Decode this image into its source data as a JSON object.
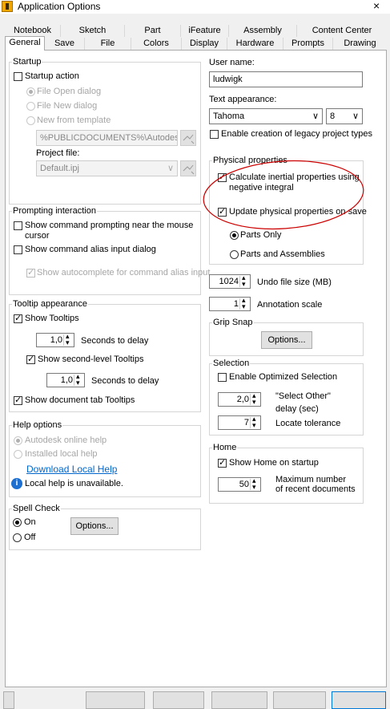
{
  "window": {
    "title": "Application Options",
    "close": "×"
  },
  "tabs_row1": [
    "Notebook",
    "Sketch",
    "Part",
    "iFeature",
    "Assembly",
    "Content Center"
  ],
  "tabs_row2": [
    "General",
    "Save",
    "File",
    "Colors",
    "Display",
    "Hardware",
    "Prompts",
    "Drawing"
  ],
  "active_tab": "General",
  "startup": {
    "group_label": "Startup",
    "startup_action": "Startup action",
    "file_open": "File Open dialog",
    "file_new": "File New dialog",
    "new_from_template": "New from template",
    "template_path": "%PUBLICDOCUMENTS%\\Autodesk\\Inv",
    "project_file_label": "Project file:",
    "project_file_value": "Default.ipj"
  },
  "prompting": {
    "group_label": "Prompting interaction",
    "show_cmd_prompting": "Show command prompting near the mouse cursor",
    "show_alias": "Show command alias input dialog",
    "show_autocomplete": "Show autocomplete for command alias input"
  },
  "tooltip": {
    "group_label": "Tooltip appearance",
    "show_tooltips": "Show Tooltips",
    "delay1_value": "1,0",
    "delay1_label": "Seconds to delay",
    "show_second": "Show second-level Tooltips",
    "delay2_value": "1,0",
    "delay2_label": "Seconds to delay",
    "show_doc_tab": "Show document tab Tooltips"
  },
  "help": {
    "group_label": "Help options",
    "online": "Autodesk online help",
    "installed": "Installed local help",
    "download": "Download Local Help",
    "unavailable": "Local help is unavailable."
  },
  "spell": {
    "group_label": "Spell Check",
    "on": "On",
    "off": "Off",
    "options": "Options..."
  },
  "user": {
    "user_name_label": "User name:",
    "user_name_value": "ludwigk",
    "text_appearance_label": "Text appearance:",
    "font": "Tahoma",
    "size": "8",
    "legacy": "Enable creation of legacy project types"
  },
  "physical": {
    "group_label": "Physical properties",
    "inertial": "Calculate inertial properties using negative integral",
    "update": "Update physical properties on save",
    "parts_only": "Parts Only",
    "parts_assemblies": "Parts and Assemblies"
  },
  "undo": {
    "value": "1024",
    "label": "Undo file size (MB)"
  },
  "annotation": {
    "value": "1",
    "label": "Annotation scale"
  },
  "grip": {
    "group_label": "Grip Snap",
    "options": "Options..."
  },
  "selection": {
    "group_label": "Selection",
    "optimized": "Enable Optimized Selection",
    "select_other_value": "2,0",
    "select_other_label": "\"Select Other\" delay (sec)",
    "locate_value": "7",
    "locate_label": "Locate tolerance"
  },
  "home": {
    "group_label": "Home",
    "show_home": "Show Home on startup",
    "max_value": "50",
    "max_label": "Maximum number of recent documents"
  },
  "colors": {
    "annotation_red": "#cc0000",
    "link_blue": "#0066cc",
    "info_blue": "#1c6fd1"
  }
}
